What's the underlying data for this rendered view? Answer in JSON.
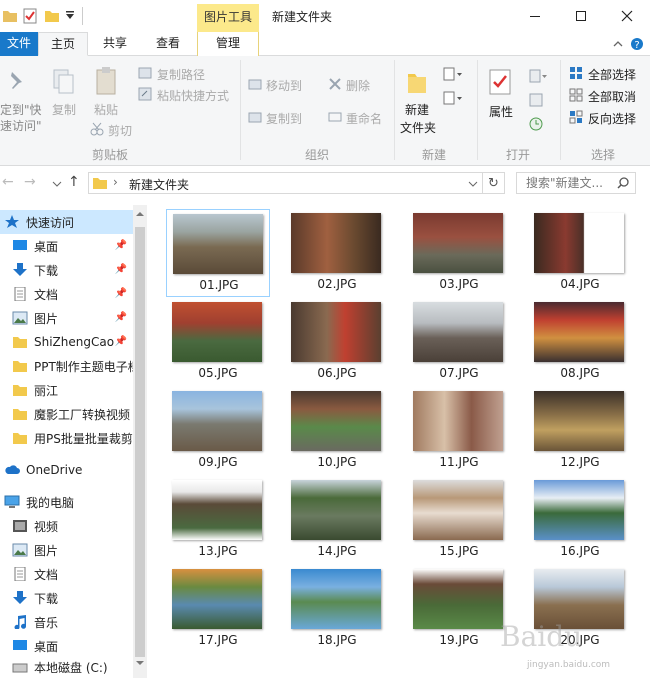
{
  "titlebar": {
    "picture_tools": "图片工具",
    "window_title": "新建文件夹"
  },
  "tabs": {
    "file": "文件",
    "home": "主页",
    "share": "共享",
    "view": "查看",
    "manage": "管理"
  },
  "ribbon": {
    "pin_to_quick": "定到\"快",
    "pin_to_quick2": "速访问\"",
    "copy": "复制",
    "paste": "粘贴",
    "copy_path": "复制路径",
    "paste_shortcut": "粘贴快捷方式",
    "cut": "剪切",
    "clipboard_group": "剪贴板",
    "move_to": "移动到",
    "copy_to": "复制到",
    "delete": "删除",
    "rename": "重命名",
    "organize_group": "组织",
    "new_folder_1": "新建",
    "new_folder_2": "文件夹",
    "new_group": "新建",
    "properties": "属性",
    "open_group": "打开",
    "select_all": "全部选择",
    "select_none": "全部取消",
    "invert_selection": "反向选择",
    "select_group": "选择"
  },
  "address": {
    "path": "新建文件夹",
    "search_placeholder": "搜索\"新建文..."
  },
  "nav": {
    "quick_access": "快速访问",
    "desktop": "桌面",
    "downloads": "下载",
    "documents": "文档",
    "pictures": "图片",
    "folder1": "ShiZhengCao",
    "folder2": "PPT制作主题电子档",
    "folder3": "丽江",
    "folder4": "魔影工厂转换视频",
    "folder5": "用PS批量批量裁剪",
    "onedrive": "OneDrive",
    "this_pc": "我的电脑",
    "videos": "视频",
    "pc_pictures": "图片",
    "pc_documents": "文档",
    "pc_downloads": "下载",
    "music": "音乐",
    "pc_desktop": "桌面",
    "local_disk": "本地磁盘 (C:)"
  },
  "files": [
    {
      "name": "01.JPG"
    },
    {
      "name": "02.JPG"
    },
    {
      "name": "03.JPG"
    },
    {
      "name": "04.JPG"
    },
    {
      "name": "05.JPG"
    },
    {
      "name": "06.JPG"
    },
    {
      "name": "07.JPG"
    },
    {
      "name": "08.JPG"
    },
    {
      "name": "09.JPG"
    },
    {
      "name": "10.JPG"
    },
    {
      "name": "11.JPG"
    },
    {
      "name": "12.JPG"
    },
    {
      "name": "13.JPG"
    },
    {
      "name": "14.JPG"
    },
    {
      "name": "15.JPG"
    },
    {
      "name": "16.JPG"
    },
    {
      "name": "17.JPG"
    },
    {
      "name": "18.JPG"
    },
    {
      "name": "19.JPG"
    },
    {
      "name": "20.JPG"
    }
  ],
  "watermark": {
    "logo": "Baidu",
    "url": "jingyan.baidu.com"
  },
  "colors": {
    "accent": "#1979ca",
    "selection": "#cce8ff",
    "tools_tab": "#fce98b"
  }
}
